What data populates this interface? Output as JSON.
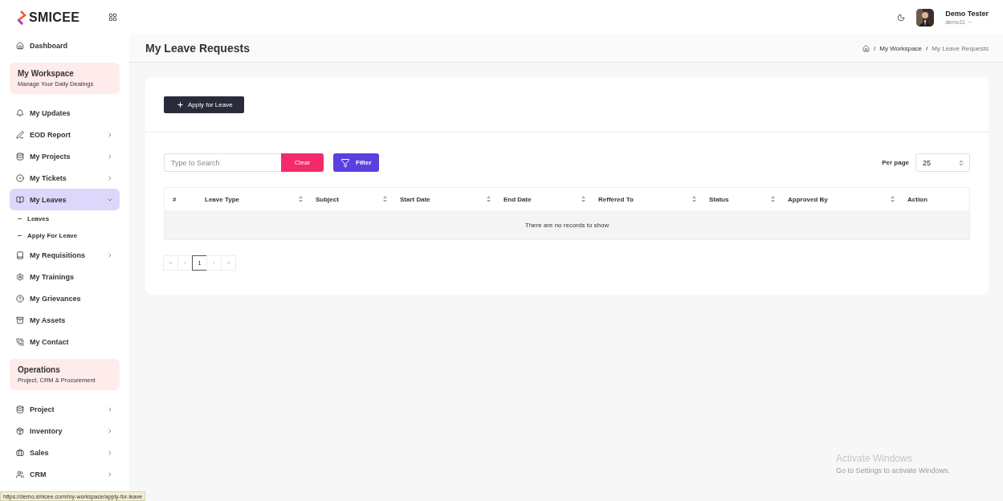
{
  "brand": {
    "name": "SMICEE"
  },
  "sidebar": {
    "items": [
      {
        "kind": "link",
        "label": "Dashboard",
        "selected": false
      },
      {
        "kind": "section",
        "title": "My Workspace",
        "subtitle": "Manage Your Daily Dealings"
      },
      {
        "kind": "link",
        "label": "My Updates",
        "selected": false
      },
      {
        "kind": "menu",
        "label": "EOD Report",
        "selected": false,
        "expanded": false
      },
      {
        "kind": "menu",
        "label": "My Projects",
        "selected": false,
        "expanded": false
      },
      {
        "kind": "menu",
        "label": "My Tickets",
        "selected": false,
        "expanded": false
      },
      {
        "kind": "menu",
        "label": "My Leaves",
        "selected": true,
        "expanded": true,
        "children": [
          {
            "label": "Leaves"
          },
          {
            "label": "Apply For Leave"
          }
        ]
      },
      {
        "kind": "menu",
        "label": "My Requisitions",
        "selected": false,
        "expanded": false
      },
      {
        "kind": "link",
        "label": "My Trainings",
        "selected": false
      },
      {
        "kind": "link",
        "label": "My Grievances",
        "selected": false
      },
      {
        "kind": "link",
        "label": "My Assets",
        "selected": false
      },
      {
        "kind": "link",
        "label": "My Contact",
        "selected": false
      },
      {
        "kind": "section",
        "title": "Operations",
        "subtitle": "Project, CRM & Procurement"
      },
      {
        "kind": "menu",
        "label": "Project",
        "selected": false,
        "expanded": false
      },
      {
        "kind": "menu",
        "label": "Inventory",
        "selected": false,
        "expanded": false
      },
      {
        "kind": "menu",
        "label": "Sales",
        "selected": false,
        "expanded": false
      },
      {
        "kind": "menu",
        "label": "CRM",
        "selected": false,
        "expanded": false
      }
    ]
  },
  "user": {
    "name": "Demo Tester",
    "username": "demo11"
  },
  "page": {
    "title": "My Leave Requests",
    "breadcrumb": [
      {
        "separator": "/",
        "label": "My Workspace"
      },
      {
        "separator": "/",
        "label": "My Leave Requests"
      }
    ]
  },
  "apply_button": "Apply for Leave",
  "search": {
    "placeholder": "Type to Search"
  },
  "clear_button": "Clear",
  "filter_button": "Filter",
  "per_page": {
    "label": "Per page",
    "value": "25"
  },
  "table": {
    "columns": [
      {
        "label": "#",
        "sortable": false
      },
      {
        "label": "Leave Type",
        "sortable": true
      },
      {
        "label": "Subject",
        "sortable": true
      },
      {
        "label": "Start Date",
        "sortable": true
      },
      {
        "label": "End Date",
        "sortable": true
      },
      {
        "label": "Reffered To",
        "sortable": true
      },
      {
        "label": "Status",
        "sortable": true
      },
      {
        "label": "Approved By",
        "sortable": true
      },
      {
        "label": "Action",
        "sortable": false
      }
    ],
    "empty_message": "There are no records to show"
  },
  "pagination": [
    {
      "label": "«",
      "selected": false,
      "disabled": true
    },
    {
      "label": "‹",
      "selected": false,
      "disabled": true
    },
    {
      "label": "1",
      "selected": true,
      "disabled": false
    },
    {
      "label": "›",
      "selected": false,
      "disabled": true
    },
    {
      "label": "»",
      "selected": false,
      "disabled": true
    }
  ],
  "os_notice": {
    "title": "Activate Windows",
    "text": "Go to Settings to activate Windows."
  },
  "status_url": "https://demo.smicee.com/my-workspace/apply-for-leave"
}
